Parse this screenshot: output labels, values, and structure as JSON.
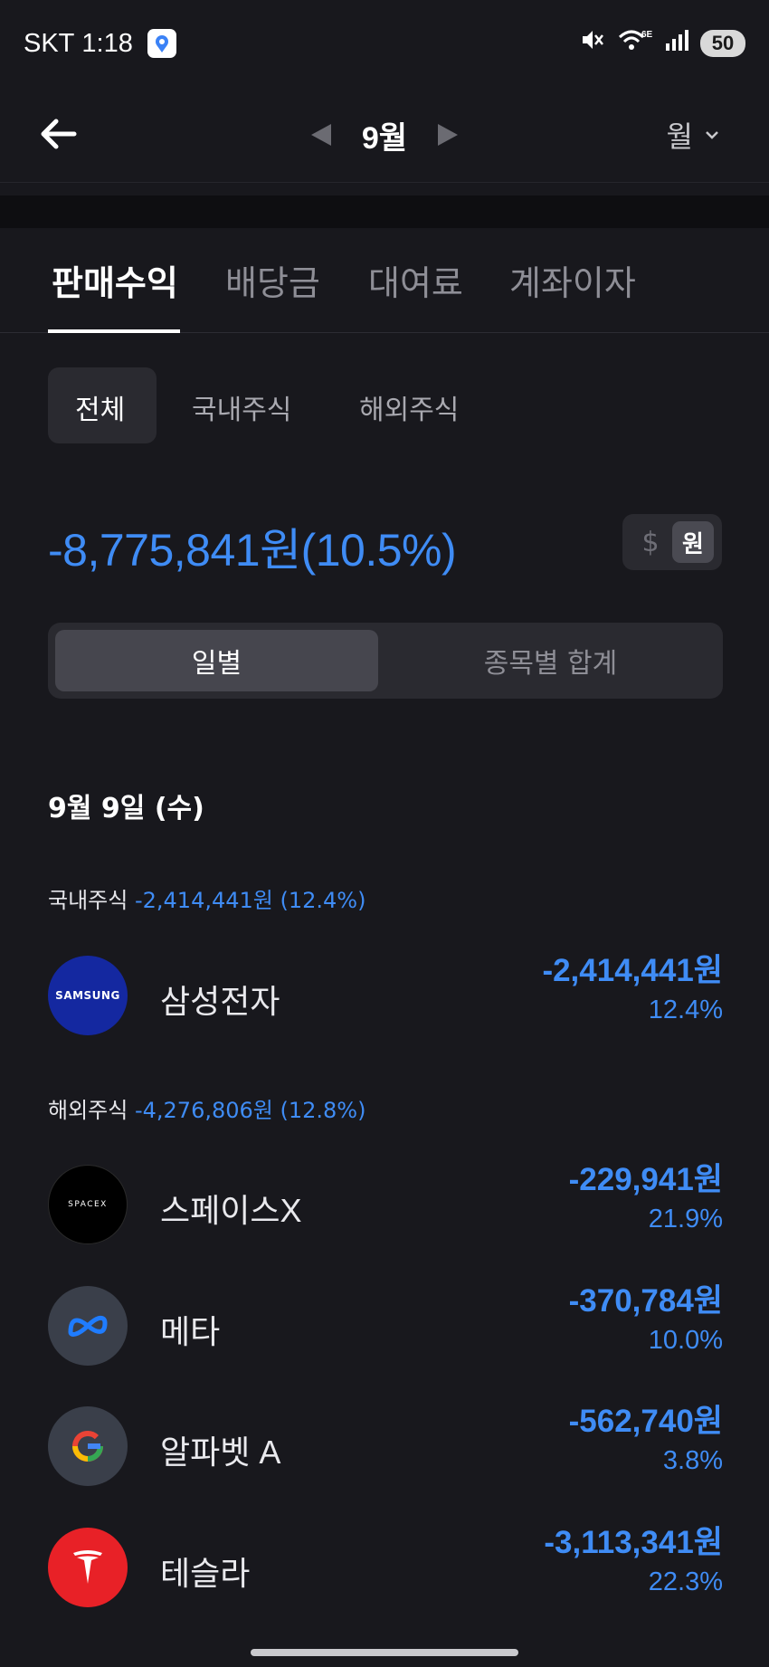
{
  "status_bar": {
    "carrier": "SKT",
    "time": "1:18",
    "network": "6E",
    "battery": "50"
  },
  "header": {
    "month": "9월",
    "period": "월"
  },
  "tabs": [
    {
      "label": "판매수익",
      "active": true
    },
    {
      "label": "배당금",
      "active": false
    },
    {
      "label": "대여료",
      "active": false
    },
    {
      "label": "계좌이자",
      "active": false
    }
  ],
  "subtabs": [
    {
      "label": "전체",
      "active": true
    },
    {
      "label": "국내주식",
      "active": false
    },
    {
      "label": "해외주식",
      "active": false
    }
  ],
  "summary": {
    "total": "-8,775,841원(10.5%)",
    "currency_usd": "$",
    "currency_won": "원"
  },
  "view_toggle": {
    "daily": "일별",
    "by_stock": "종목별 합계"
  },
  "date_header": "9월 9일 (수)",
  "domestic": {
    "label": "국내주식",
    "amount": "-2,414,441원 (12.4%)",
    "stocks": [
      {
        "name": "삼성전자",
        "logo_text": "SAMSUNG",
        "amount": "-2,414,441원",
        "pct": "12.4%"
      }
    ]
  },
  "overseas": {
    "label": "해외주식",
    "amount": "-4,276,806원 (12.8%)",
    "stocks": [
      {
        "name": "스페이스X",
        "logo_text": "SPACEX",
        "amount": "-229,941원",
        "pct": "21.9%"
      },
      {
        "name": "메타",
        "amount": "-370,784원",
        "pct": "10.0%"
      },
      {
        "name": "알파벳 A",
        "amount": "-562,740원",
        "pct": "3.8%"
      },
      {
        "name": "테슬라",
        "amount": "-3,113,341원",
        "pct": "22.3%"
      }
    ]
  },
  "colors": {
    "background": "#18181d",
    "accent_blue": "#3f8cf5",
    "samsung": "#1428a0",
    "tesla": "#e82127"
  }
}
